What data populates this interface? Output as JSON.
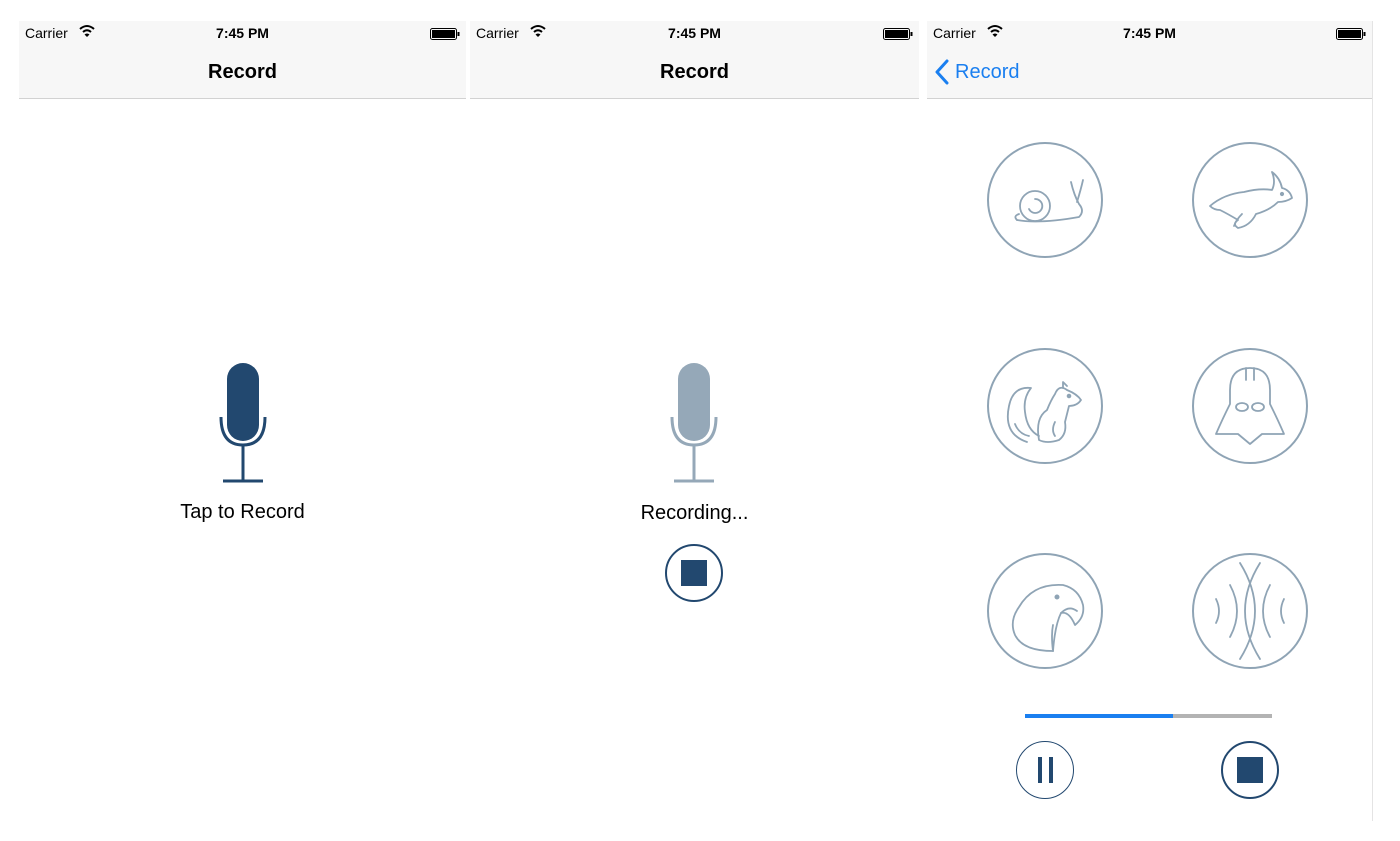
{
  "colors": {
    "accent": "#1a7ff0",
    "primary": "#22486f",
    "disabled": "#95a8b8",
    "outline": "#8fa4b5"
  },
  "screens": [
    {
      "status": {
        "carrier": "Carrier",
        "time": "7:45 PM"
      },
      "nav": {
        "title": "Record"
      },
      "label": "Tap to Record",
      "mic_icon": "microphone-icon"
    },
    {
      "status": {
        "carrier": "Carrier",
        "time": "7:45 PM"
      },
      "nav": {
        "title": "Record"
      },
      "label": "Recording...",
      "mic_icon": "microphone-icon",
      "stop_icon": "stop-icon"
    },
    {
      "status": {
        "carrier": "Carrier",
        "time": "7:45 PM"
      },
      "nav": {
        "back_label": "Record"
      },
      "effects": [
        "snail-icon",
        "rabbit-icon",
        "squirrel-icon",
        "darth-vader-icon",
        "parrot-icon",
        "echo-icon"
      ],
      "playback_progress": 0.6,
      "controls": [
        "pause-icon",
        "stop-icon"
      ]
    }
  ]
}
